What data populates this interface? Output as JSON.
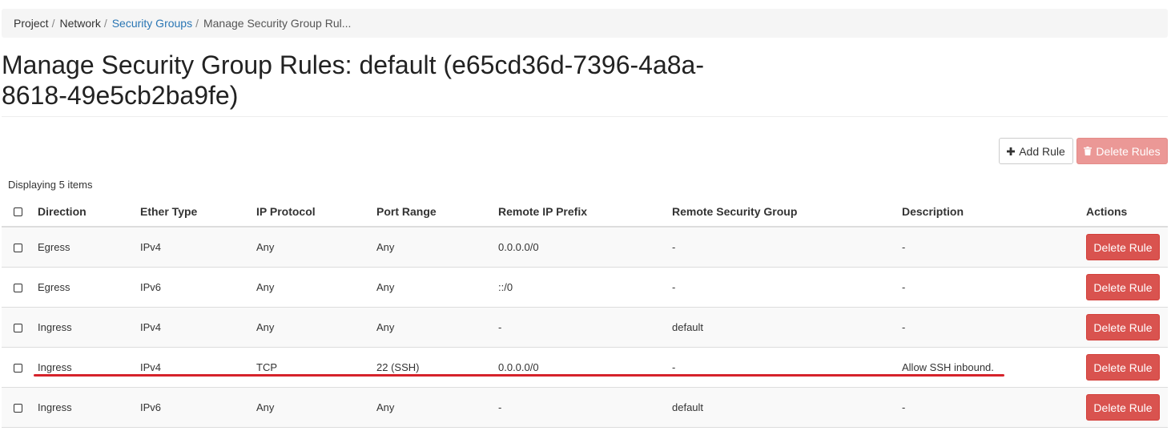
{
  "breadcrumb": {
    "items": [
      "Project",
      "Network",
      "Security Groups",
      "Manage Security Group Rul..."
    ],
    "separator": "/"
  },
  "page": {
    "title_line1": "Manage Security Group Rules: default (e65cd36d-7396-4a8a-",
    "title_line2": "8618-49e5cb2ba9fe)"
  },
  "toolbar": {
    "add_rule_label": "Add Rule",
    "add_rule_icon": "plus-icon",
    "delete_rules_label": "Delete Rules",
    "delete_rules_icon": "trash-icon"
  },
  "table": {
    "display_count": "Displaying 5 items",
    "columns": [
      "Direction",
      "Ether Type",
      "IP Protocol",
      "Port Range",
      "Remote IP Prefix",
      "Remote Security Group",
      "Description",
      "Actions"
    ],
    "rows": [
      {
        "direction": "Egress",
        "ether_type": "IPv4",
        "ip_protocol": "Any",
        "port_range": "Any",
        "remote_ip_prefix": "0.0.0.0/0",
        "remote_security_group": "-",
        "description": "-",
        "action_label": "Delete Rule"
      },
      {
        "direction": "Egress",
        "ether_type": "IPv6",
        "ip_protocol": "Any",
        "port_range": "Any",
        "remote_ip_prefix": "::/0",
        "remote_security_group": "-",
        "description": "-",
        "action_label": "Delete Rule"
      },
      {
        "direction": "Ingress",
        "ether_type": "IPv4",
        "ip_protocol": "Any",
        "port_range": "Any",
        "remote_ip_prefix": "-",
        "remote_security_group": "default",
        "description": "-",
        "action_label": "Delete Rule"
      },
      {
        "direction": "Ingress",
        "ether_type": "IPv4",
        "ip_protocol": "TCP",
        "port_range": "22 (SSH)",
        "remote_ip_prefix": "0.0.0.0/0",
        "remote_security_group": "-",
        "description": "Allow SSH inbound.",
        "action_label": "Delete Rule"
      },
      {
        "direction": "Ingress",
        "ether_type": "IPv6",
        "ip_protocol": "Any",
        "port_range": "Any",
        "remote_ip_prefix": "-",
        "remote_security_group": "default",
        "description": "-",
        "action_label": "Delete Rule"
      }
    ]
  },
  "colors": {
    "link": "#2a76b4",
    "danger": "#d9534f",
    "danger_disabled": "#eb9896",
    "annotation_underline": "#d6232b"
  }
}
